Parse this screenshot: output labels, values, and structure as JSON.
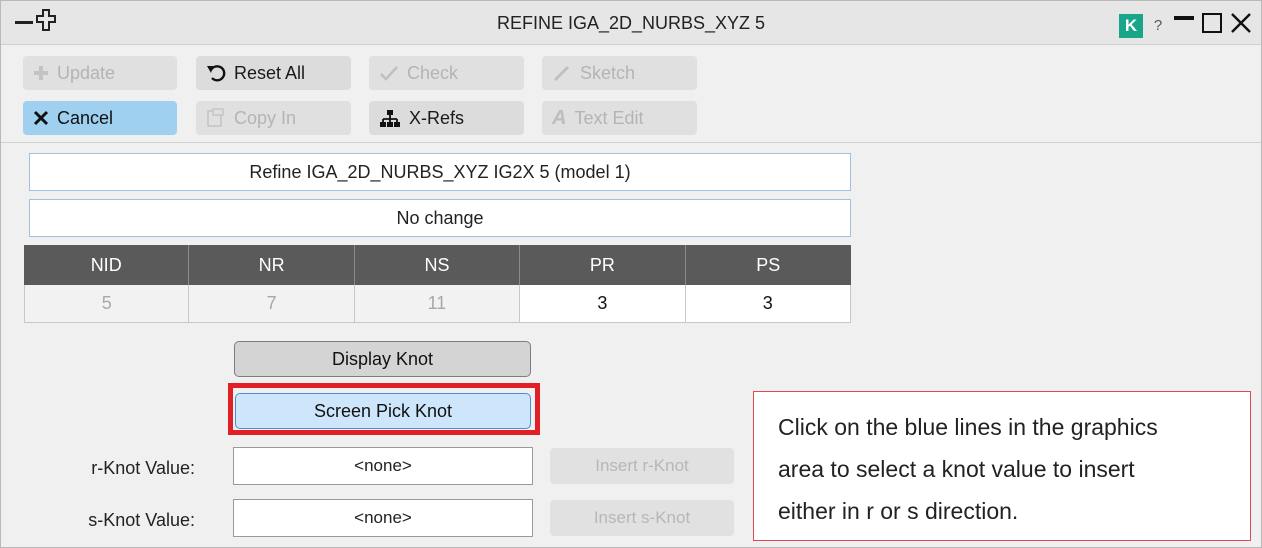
{
  "window": {
    "title": "REFINE IGA_2D_NURBS_XYZ 5",
    "k_badge": "K",
    "help": "?"
  },
  "toolbar": {
    "update": "Update",
    "reset_all": "Reset All",
    "check": "Check",
    "sketch": "Sketch",
    "cancel": "Cancel",
    "copy_in": "Copy In",
    "x_refs": "X-Refs",
    "text_edit": "Text Edit"
  },
  "info": {
    "heading": "Refine IGA_2D_NURBS_XYZ IG2X 5 (model 1)",
    "status": "No change"
  },
  "table": {
    "headers": [
      "NID",
      "NR",
      "NS",
      "PR",
      "PS"
    ],
    "values": [
      "5",
      "7",
      "11",
      "3",
      "3"
    ]
  },
  "actions": {
    "display_knot": "Display Knot",
    "screen_pick_knot": "Screen Pick Knot"
  },
  "knots": {
    "r_label": "r-Knot Value:",
    "r_value": "<none>",
    "r_insert": "Insert r-Knot",
    "s_label": "s-Knot Value:",
    "s_value": "<none>",
    "s_insert": "Insert s-Knot"
  },
  "callout": {
    "line1": "Click on the blue lines in the graphics",
    "line2": "area to select a knot value to insert",
    "line3": "either in r or s direction."
  },
  "colors": {
    "accent_red": "#e01f26",
    "selected_blue": "#cde6fb",
    "header_gray": "#5a5a5a",
    "k_green": "#19a589"
  }
}
